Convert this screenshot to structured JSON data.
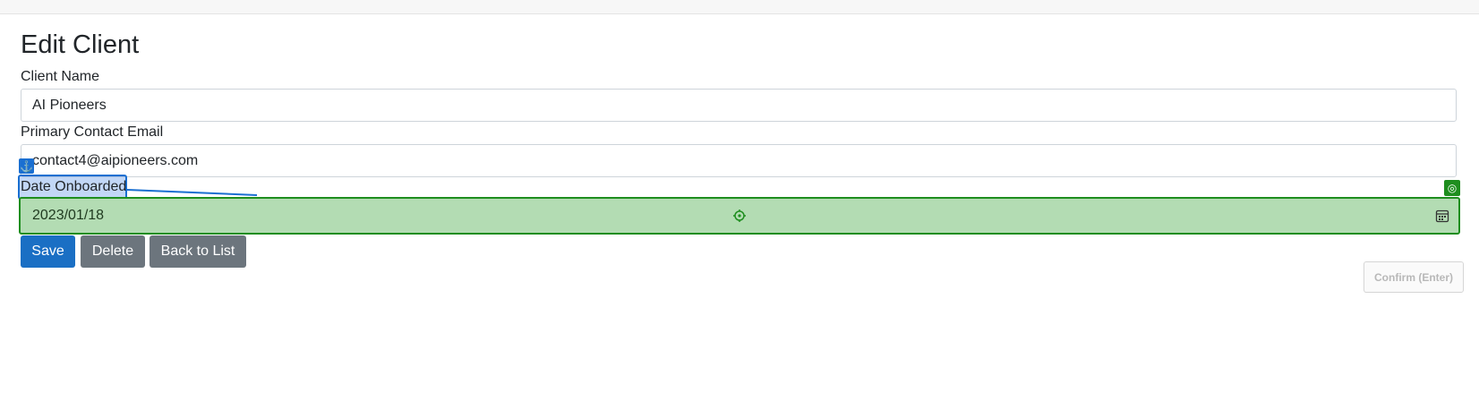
{
  "page": {
    "title": "Edit Client"
  },
  "form": {
    "client_name": {
      "label": "Client Name",
      "value": "AI Pioneers"
    },
    "email": {
      "label": "Primary Contact Email",
      "value": "contact4@aipioneers.com"
    },
    "date_onboarded": {
      "label": "Date Onboarded",
      "value": "2023/01/18"
    }
  },
  "actions": {
    "save": "Save",
    "delete": "Delete",
    "back": "Back to List"
  },
  "overlay": {
    "confirm": "Confirm (Enter)"
  },
  "colors": {
    "primary": "#1a6fc4",
    "secondary": "#6c757d",
    "highlight_green": "#1e8e1e",
    "anchor_blue": "#1a6fd1"
  },
  "icons": {
    "anchor": "anchor-icon",
    "target": "crosshair-icon",
    "calendar": "calendar-icon",
    "badge": "target-badge-icon"
  }
}
